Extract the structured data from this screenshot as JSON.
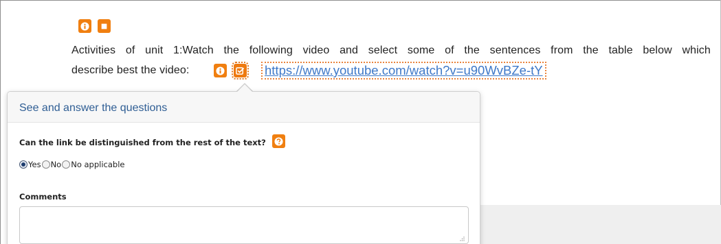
{
  "accent_color": "#f07f10",
  "link_color": "#3d78c8",
  "title_color": "#2f5e94",
  "top_toolbar": {
    "icons": [
      "info-icon",
      "stop-icon"
    ]
  },
  "activity": {
    "line1_words": [
      "Activities",
      "of",
      "unit",
      "1:Watch",
      "the",
      "following",
      "video",
      "and",
      "select",
      "some",
      "of",
      "the",
      "sentences",
      "from",
      "the",
      "table",
      "below",
      "which"
    ],
    "line2_text": "describe best the video:",
    "inline_icons": [
      "info-icon",
      "checklist-icon"
    ],
    "link_text": "https://www.youtube.com/watch?v=u90WvBZe-tY"
  },
  "popover": {
    "title": "See and answer the questions",
    "question": "Can the link be distinguished from the rest of the text?",
    "help_icon": "question-icon",
    "options": [
      {
        "label": "Yes",
        "checked": true
      },
      {
        "label": "No",
        "checked": false
      },
      {
        "label": "No applicable",
        "checked": false
      }
    ],
    "comments_label": "Comments",
    "comments_value": ""
  }
}
